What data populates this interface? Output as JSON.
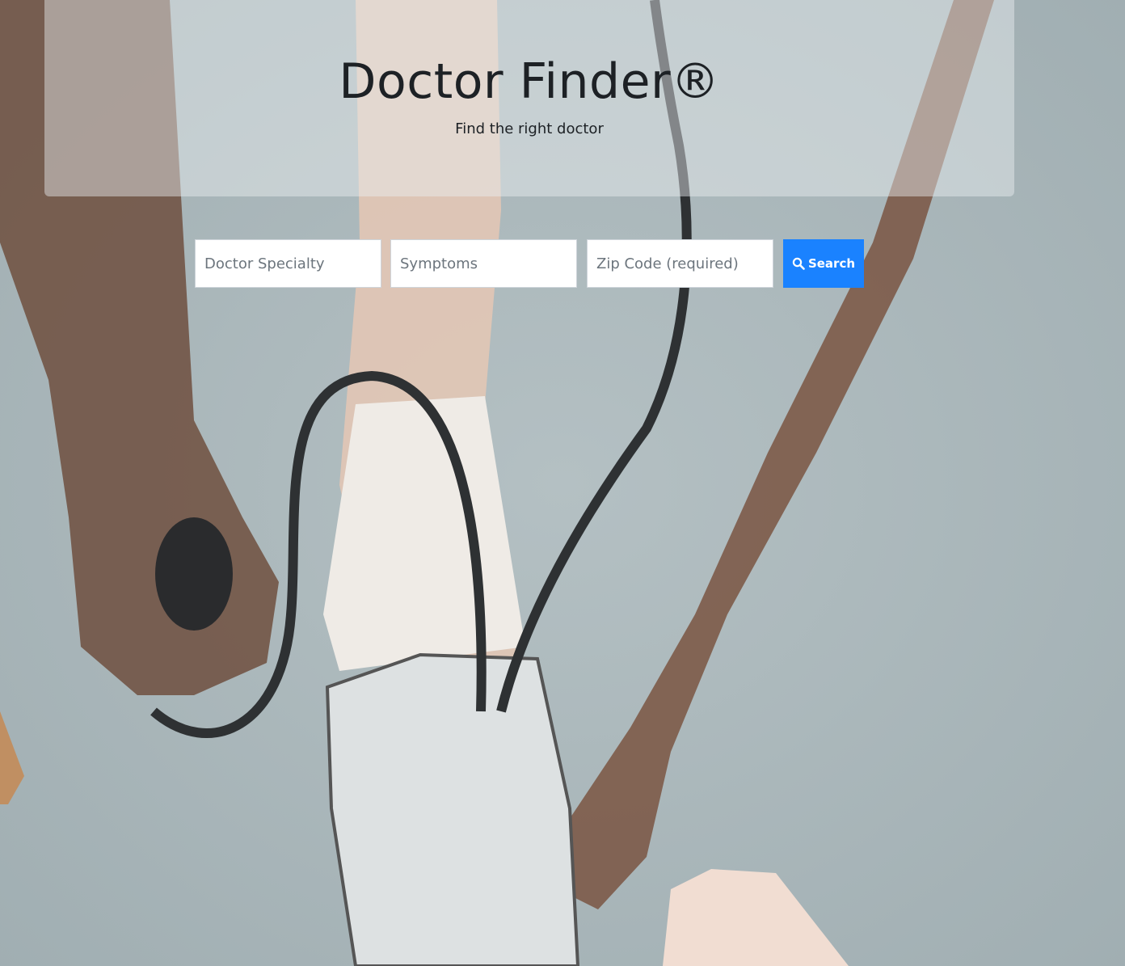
{
  "header": {
    "title": "Doctor Finder®",
    "subtitle": "Find the right doctor"
  },
  "search": {
    "specialty_placeholder": "Doctor Specialty",
    "symptoms_placeholder": "Symptoms",
    "zip_placeholder": "Zip Code (required)",
    "button_label": "Search",
    "button_icon": "search-icon"
  },
  "colors": {
    "accent": "#1a82ff",
    "heading_text": "#1d2125"
  }
}
